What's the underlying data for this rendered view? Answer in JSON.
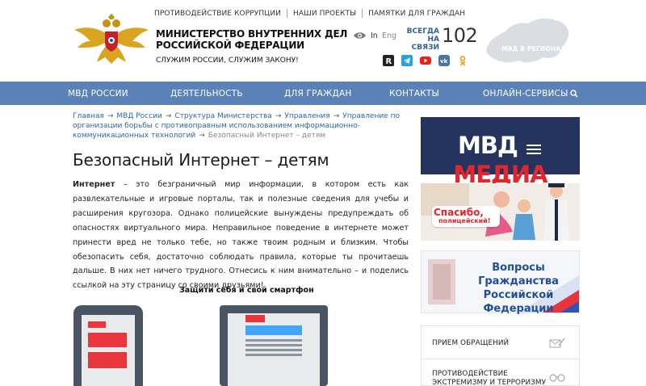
{
  "topnav": [
    "ПРОТИВОДЕЙСТВИЕ КОРРУПЦИИ",
    "НАШИ ПРОЕКТЫ",
    "ПАМЯТКИ ДЛЯ ГРАЖДАН"
  ],
  "org": {
    "title_line1": "МИНИСТЕРСТВО ВНУТРЕННИХ ДЕЛ",
    "title_line2": "РОССИЙСКОЙ ФЕДЕРАЦИИ",
    "motto": "СЛУЖИМ РОССИИ, СЛУЖИМ ЗАКОНУ!"
  },
  "lang": {
    "in": "In",
    "eng": "Eng"
  },
  "hotline": {
    "line1": "ВСЕГДА",
    "line2": "НА СВЯЗИ",
    "number": "102"
  },
  "regions_label": "МВД В РЕГИОНАХ",
  "social": [
    "rutube-icon",
    "telegram-icon",
    "youtube-icon",
    "vk-icon",
    "ok-icon"
  ],
  "mainnav": [
    "МВД РОССИИ",
    "ДЕЯТЕЛЬНОСТЬ",
    "ДЛЯ ГРАЖДАН",
    "КОНТАКТЫ",
    "ОНЛАЙН-СЕРВИСЫ"
  ],
  "breadcrumb": {
    "items": [
      "Главная",
      "МВД России",
      "Структура Министерства",
      "Управления",
      "Управление по организации борьбы с противоправным использованием информационно-коммуникационных технологий"
    ],
    "current": "Безопасный Интернет – детям"
  },
  "page_title": "Безопасный Интернет – детям",
  "intro": {
    "bold": "Интернет",
    "text": " – это безграничный мир информации, в котором есть как развлекательные и игровые порталы, так и полезные сведения для учебы и расширения кругозора. Однако полицейские вынуждены предупреждать об опасностях виртуального мира. Неправильное поведение в интернете может принести вред не только тебе, но также твоим родным и близким. Чтобы обезопасить себя, достаточно соблюдать правила, которые ты прочитаешь дальше. В них нет ничего трудного. Отнесись к ним внимательно – и поделись ссылкой на эту страницу со своими друзьями!"
  },
  "subhead": "Защити себя и свой смартфон",
  "banners": {
    "media": {
      "white": "МВД",
      "red": "МЕДИА"
    },
    "thanks": {
      "line1": "Спасибо,",
      "line2": "полицейский!"
    },
    "questions": {
      "line1": "Вопросы",
      "line2": "Гражданства",
      "line3": "Российской Федерации"
    }
  },
  "services": [
    {
      "label1": "ПРИЕМ ОБРАЩЕНИЙ",
      "label2": "",
      "icon": "envelope-pen-icon"
    },
    {
      "label1": "ПРОТИВОДЕЙСТВИЕ",
      "label2": "ЭКСТРЕМИЗМУ И ТЕРРОРИЗМУ",
      "icon": "handcuffs-icon"
    }
  ],
  "colors": {
    "nav": "#5a82b8",
    "link": "#2d67b0",
    "accent_red": "#e3262d",
    "hotline": "#2f5f9e"
  }
}
